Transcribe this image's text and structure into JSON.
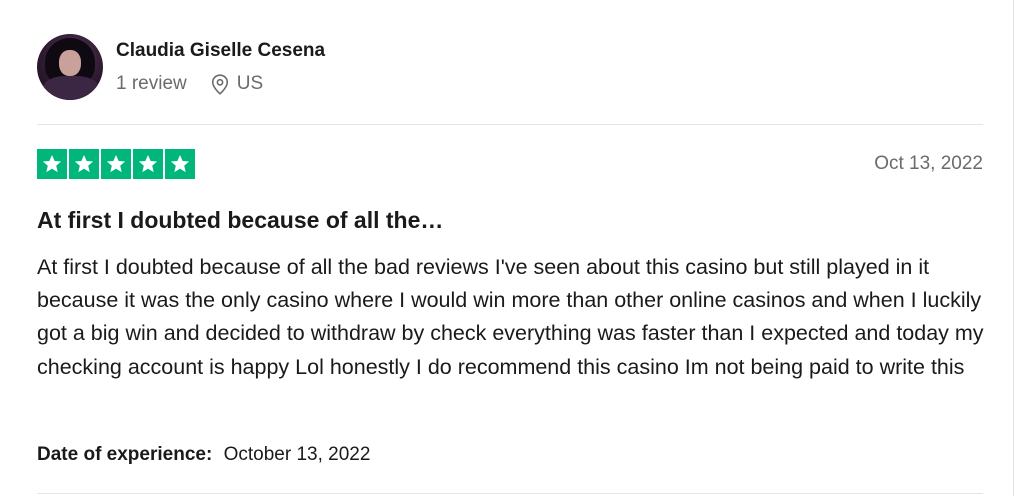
{
  "reviewer": {
    "name": "Claudia Giselle Cesena",
    "review_count": "1 review",
    "location": "US",
    "location_icon": "location-pin-icon"
  },
  "review": {
    "rating": 5,
    "rating_max": 5,
    "star_color": "#00b67a",
    "date": "Oct 13, 2022",
    "title": "At first I doubted because of all the…",
    "body": "At first I doubted because of all the bad reviews I've seen about this casino but still played in it because it was the only casino where I would win more than other online casinos and when I luckily got a big win and decided to withdraw by check everything was faster than I expected and today my checking account is happy Lol honestly I do recommend this casino Im not being paid to write this",
    "experience_label": "Date of experience:",
    "experience_date": "October 13, 2022"
  }
}
